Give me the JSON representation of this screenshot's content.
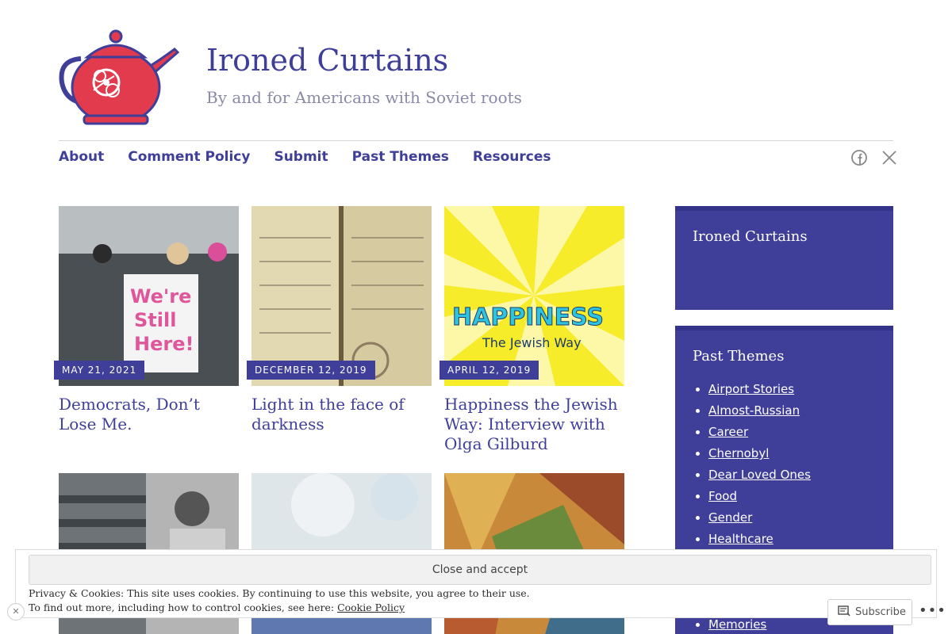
{
  "site": {
    "title": "Ironed Curtains",
    "description": "By and for Americans with Soviet roots",
    "accent": "#3f3f9a"
  },
  "nav": {
    "items": [
      "About",
      "Comment Policy",
      "Submit",
      "Past Themes",
      "Resources"
    ],
    "social": [
      "facebook-icon",
      "x-icon"
    ]
  },
  "posts": [
    {
      "date": "MAY 21, 2021",
      "title": "Democrats, Don’t Lose Me."
    },
    {
      "date": "DECEMBER 12, 2019",
      "title": "Light in the face of darkness"
    },
    {
      "date": "APRIL 12, 2019",
      "title": "Happiness the Jewish Way: Interview with Olga Gilburd"
    },
    {
      "date": "",
      "title": ""
    },
    {
      "date": "",
      "title": ""
    },
    {
      "date": "",
      "title": ""
    }
  ],
  "sidebar": {
    "widget1_title": "Ironed Curtains",
    "widget2_title": "Past Themes",
    "themes": [
      "Airport Stories",
      "Almost-Russian",
      "Career",
      "Chernobyl",
      "Dear Loved Ones",
      "Food",
      "Gender",
      "Healthcare",
      "Memories"
    ]
  },
  "cookie": {
    "button": "Close and accept",
    "line1": "Privacy & Cookies: This site uses cookies. By continuing to use this website, you agree to their use.",
    "line2_prefix": "To find out more, including how to control cookies, see here:",
    "link": "Cookie Policy"
  },
  "actionbar": {
    "subscribe": "Subscribe",
    "more": "•••"
  }
}
